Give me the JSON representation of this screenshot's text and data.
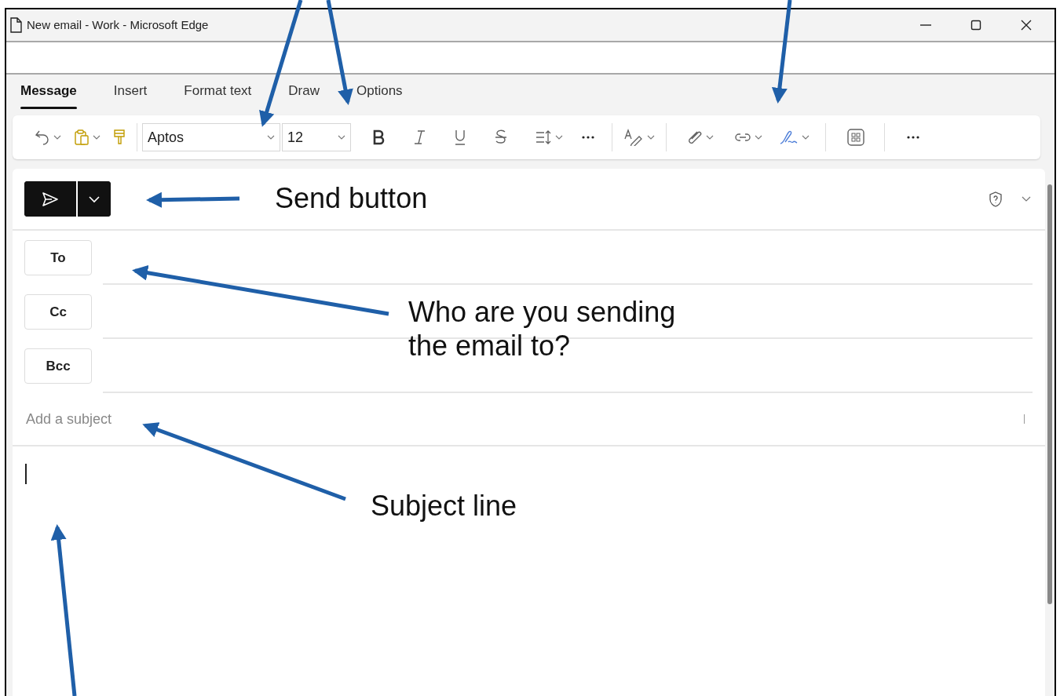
{
  "window": {
    "title": "New email - Work - Microsoft Edge"
  },
  "tabs": [
    {
      "label": "Message",
      "selected": true
    },
    {
      "label": "Insert",
      "selected": false
    },
    {
      "label": "Format text",
      "selected": false
    },
    {
      "label": "Draw",
      "selected": false
    },
    {
      "label": "Options",
      "selected": false
    }
  ],
  "toolbar": {
    "font_name": {
      "value": "Aptos"
    },
    "font_size": {
      "value": "12"
    }
  },
  "recipients": [
    {
      "label": "To"
    },
    {
      "label": "Cc"
    },
    {
      "label": "Bcc"
    }
  ],
  "subject": {
    "placeholder": "Add a subject"
  },
  "callouts": [
    {
      "text": "Send button"
    },
    {
      "text": "Who are you sending the email to?"
    },
    {
      "text": "Subject line"
    }
  ]
}
